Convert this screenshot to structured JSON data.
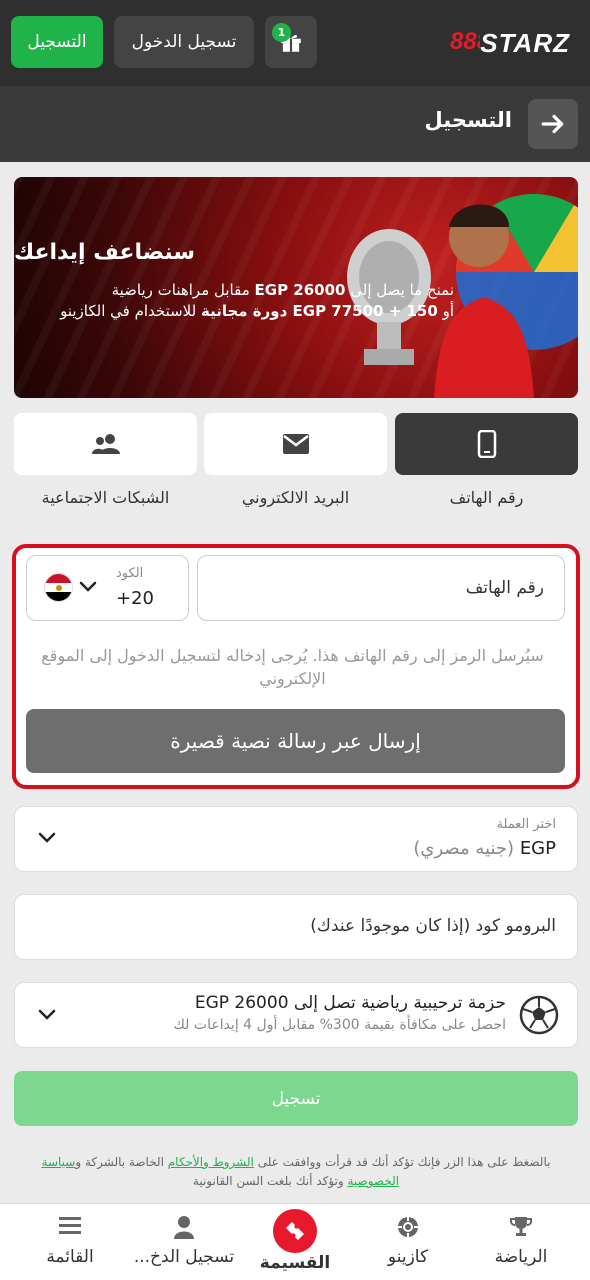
{
  "header": {
    "register_label": "التسجيل",
    "login_label": "تسجيل الدخول",
    "gift_count": "1",
    "logo_num": "888",
    "logo_text": "STARZ"
  },
  "page": {
    "title": "التسجيل"
  },
  "banner": {
    "title": "سنضاعف إيداعك",
    "line1_a": "نمنح ما يصل إلى ",
    "line1_b": "EGP 26000",
    "line1_c": " مقابل مراهنات رياضية",
    "line2_a": "أو ",
    "line2_b": "EGP 77500 + 150 دورة مجانية",
    "line2_c": " للاستخدام في الكازينو"
  },
  "methods": [
    {
      "label": "رقم الهاتف",
      "icon": "phone-icon",
      "active": true
    },
    {
      "label": "البريد الالكتروني",
      "icon": "envelope-icon",
      "active": false
    },
    {
      "label": "الشبكات الاجتماعية",
      "icon": "users-icon",
      "active": false
    }
  ],
  "phone_form": {
    "phone_placeholder": "رقم الهاتف",
    "code_label": "الكود",
    "code_value": "+20",
    "note": "سيُرسل الرمز إلى رقم الهاتف هذا. يُرجى إدخاله لتسجيل الدخول إلى الموقع الإلكتروني",
    "sms_button": "إرسال عبر رسالة نصية قصيرة"
  },
  "currency": {
    "label": "اختر العملة",
    "code": "EGP",
    "name": "(جنيه مصري)"
  },
  "promo": {
    "placeholder": "البرومو كود (إذا كان موجودًا عندك)"
  },
  "bonus": {
    "title": "حزمة ترحيبية رياضية تصل إلى EGP 26000",
    "subtitle": "احصل على مكافأة بقيمة 300% مقابل أول 4 إيداعات لك"
  },
  "register_button": "تسجيل",
  "terms": {
    "t1": "بالضغط على هذا الزر فإنك تؤكد أنك قد قرأت ووافقت على ",
    "link1": "الشروط والأحكام",
    "t2": " الخاصة بالشركة و",
    "link2": "سياسة الخصوصية",
    "t3": " وتؤكد أنك بلغت السن القانونية"
  },
  "bottom_nav": [
    {
      "label": "القائمة",
      "icon": "menu-icon"
    },
    {
      "label": "تسجيل الدخ...",
      "icon": "user-icon"
    },
    {
      "label": "القسيمة",
      "icon": "coupon-icon"
    },
    {
      "label": "كازينو",
      "icon": "casino-chip-icon"
    },
    {
      "label": "الرياضة",
      "icon": "trophy-icon"
    }
  ],
  "colors": {
    "accent_green": "#1fb34a",
    "brand_red": "#e8192c",
    "header_dark": "#2f2f2f"
  }
}
